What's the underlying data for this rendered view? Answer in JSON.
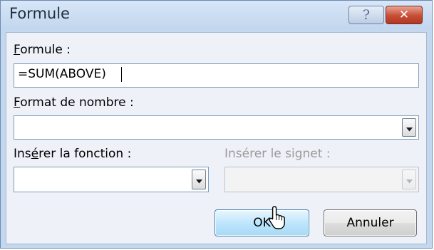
{
  "dialog": {
    "title": "Formule",
    "help_glyph": "?",
    "close_glyph": "✕"
  },
  "formula": {
    "label_accel": "F",
    "label_rest": "ormule :",
    "value": "=SUM(ABOVE)"
  },
  "number_format": {
    "label_accel": "F",
    "label_rest": "ormat de nombre :",
    "value": ""
  },
  "insert_function": {
    "label_pre": "Ins",
    "label_accel": "é",
    "label_rest": "rer la fonction :",
    "value": ""
  },
  "insert_bookmark": {
    "label": "Insérer le signet :",
    "value": ""
  },
  "buttons": {
    "ok_label": "OK",
    "cancel_label": "Annuler"
  },
  "colors": {
    "close_button": "#c74c35",
    "ok_button_accent": "#3c7fb1"
  }
}
